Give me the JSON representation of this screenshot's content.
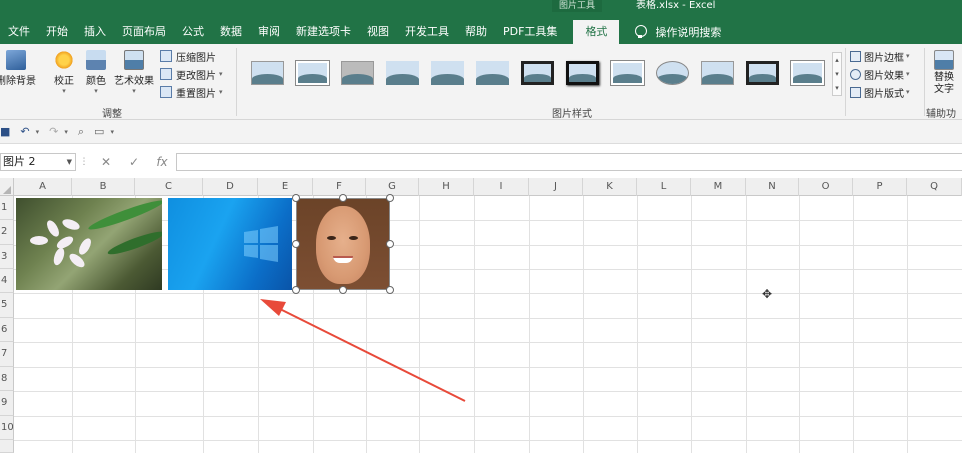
{
  "title_bar": {
    "context_label": "图片工具",
    "doc_title": "表格.xlsx  -  Excel"
  },
  "tabs": [
    "文件",
    "开始",
    "插入",
    "页面布局",
    "公式",
    "数据",
    "审阅",
    "新建选项卡",
    "视图",
    "开发工具",
    "帮助",
    "PDF工具集"
  ],
  "active_tab": "格式",
  "tell_me": "操作说明搜索",
  "ribbon": {
    "remove_bg": "删除背景",
    "corrections": "校正",
    "color": "颜色",
    "artistic": "艺术效果",
    "compress": "压缩图片",
    "change": "更改图片",
    "reset": "重置图片",
    "adjust_group": "调整",
    "styles_group": "图片样式",
    "border": "图片边框",
    "effects": "图片效果",
    "layout": "图片版式",
    "alt_text": "替换\n文字",
    "alt_group": "辅助功能"
  },
  "name_box": "图片 2",
  "formula_buttons": {
    "cancel": "✕",
    "enter": "✓",
    "fx": "fx"
  },
  "columns": [
    "A",
    "B",
    "C",
    "D",
    "E",
    "F",
    "G",
    "H",
    "I",
    "J",
    "K",
    "L",
    "M",
    "N",
    "O",
    "P",
    "Q"
  ],
  "rows": [
    "1",
    "2",
    "3",
    "4",
    "5",
    "6",
    "7",
    "8",
    "9",
    "10"
  ],
  "colors": {
    "excel_green": "#217346",
    "arrow_red": "#e84a3a",
    "ribbon_bg": "#f3f3f3"
  }
}
